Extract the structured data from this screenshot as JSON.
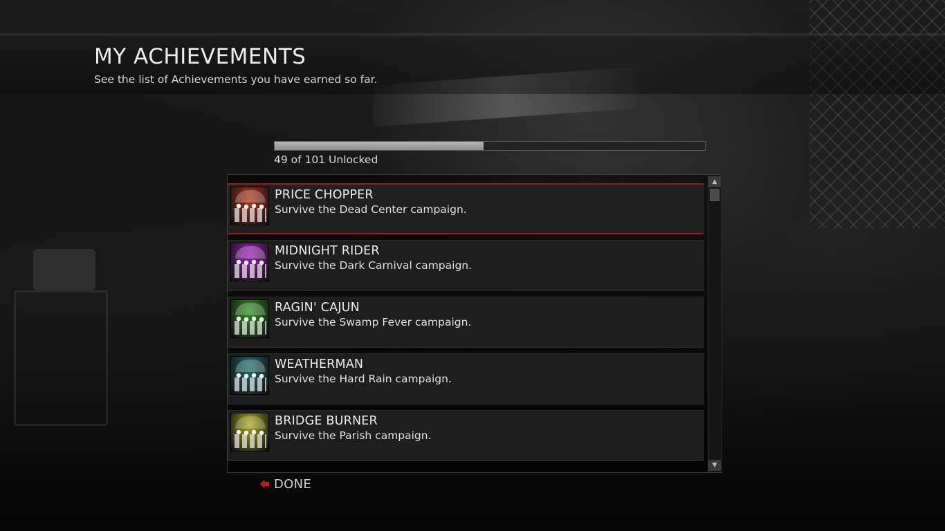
{
  "header": {
    "title": "MY ACHIEVEMENTS",
    "subtitle": "See the list of Achievements you have earned so far."
  },
  "progress": {
    "unlocked": 49,
    "total": 101,
    "fraction": 0.485,
    "label": "49 of 101 Unlocked"
  },
  "achievements": [
    {
      "title": "PRICE CHOPPER",
      "description": "Survive the Dead Center campaign.",
      "selected": true,
      "icon": "dead-center-survivors-icon",
      "tint": "#b0361e"
    },
    {
      "title": "MIDNIGHT RIDER",
      "description": "Survive the Dark Carnival campaign.",
      "selected": false,
      "icon": "dark-carnival-survivors-icon",
      "tint": "#9a1fb8"
    },
    {
      "title": "RAGIN' CAJUN",
      "description": "Survive the Swamp Fever campaign.",
      "selected": false,
      "icon": "swamp-fever-survivors-icon",
      "tint": "#2f8f1e"
    },
    {
      "title": "WEATHERMAN",
      "description": "Survive the Hard Rain campaign.",
      "selected": false,
      "icon": "hard-rain-survivors-icon",
      "tint": "#1e6b6b"
    },
    {
      "title": "BRIDGE BURNER",
      "description": "Survive the Parish campaign.",
      "selected": false,
      "icon": "parish-survivors-icon",
      "tint": "#a8a81a"
    }
  ],
  "footer": {
    "done_label": "DONE",
    "done_icon": "back-arrow-icon",
    "accent": "#c4161c"
  }
}
